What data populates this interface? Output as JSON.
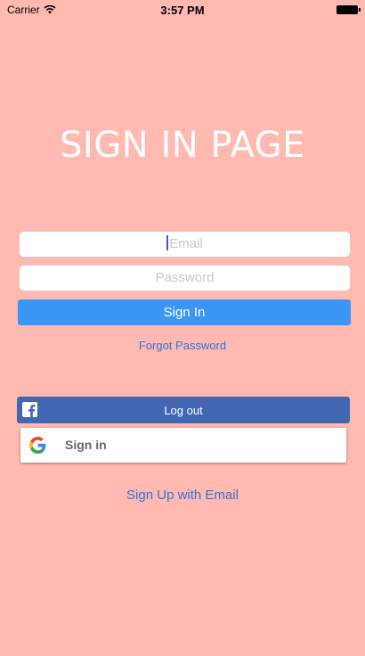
{
  "status_bar": {
    "carrier": "Carrier",
    "time": "3:57 PM"
  },
  "title": "SIGN IN PAGE",
  "form": {
    "email_placeholder": "Email",
    "password_placeholder": "Password",
    "sign_in_label": "Sign In",
    "forgot_label": "Forgot Password"
  },
  "social": {
    "facebook_label": "Log out",
    "google_label": "Sign in"
  },
  "signup_label": "Sign Up with Email",
  "colors": {
    "background": "#ffb9b0",
    "primary": "#3a96f5",
    "link": "#2f72d8",
    "facebook": "#4267b2"
  }
}
